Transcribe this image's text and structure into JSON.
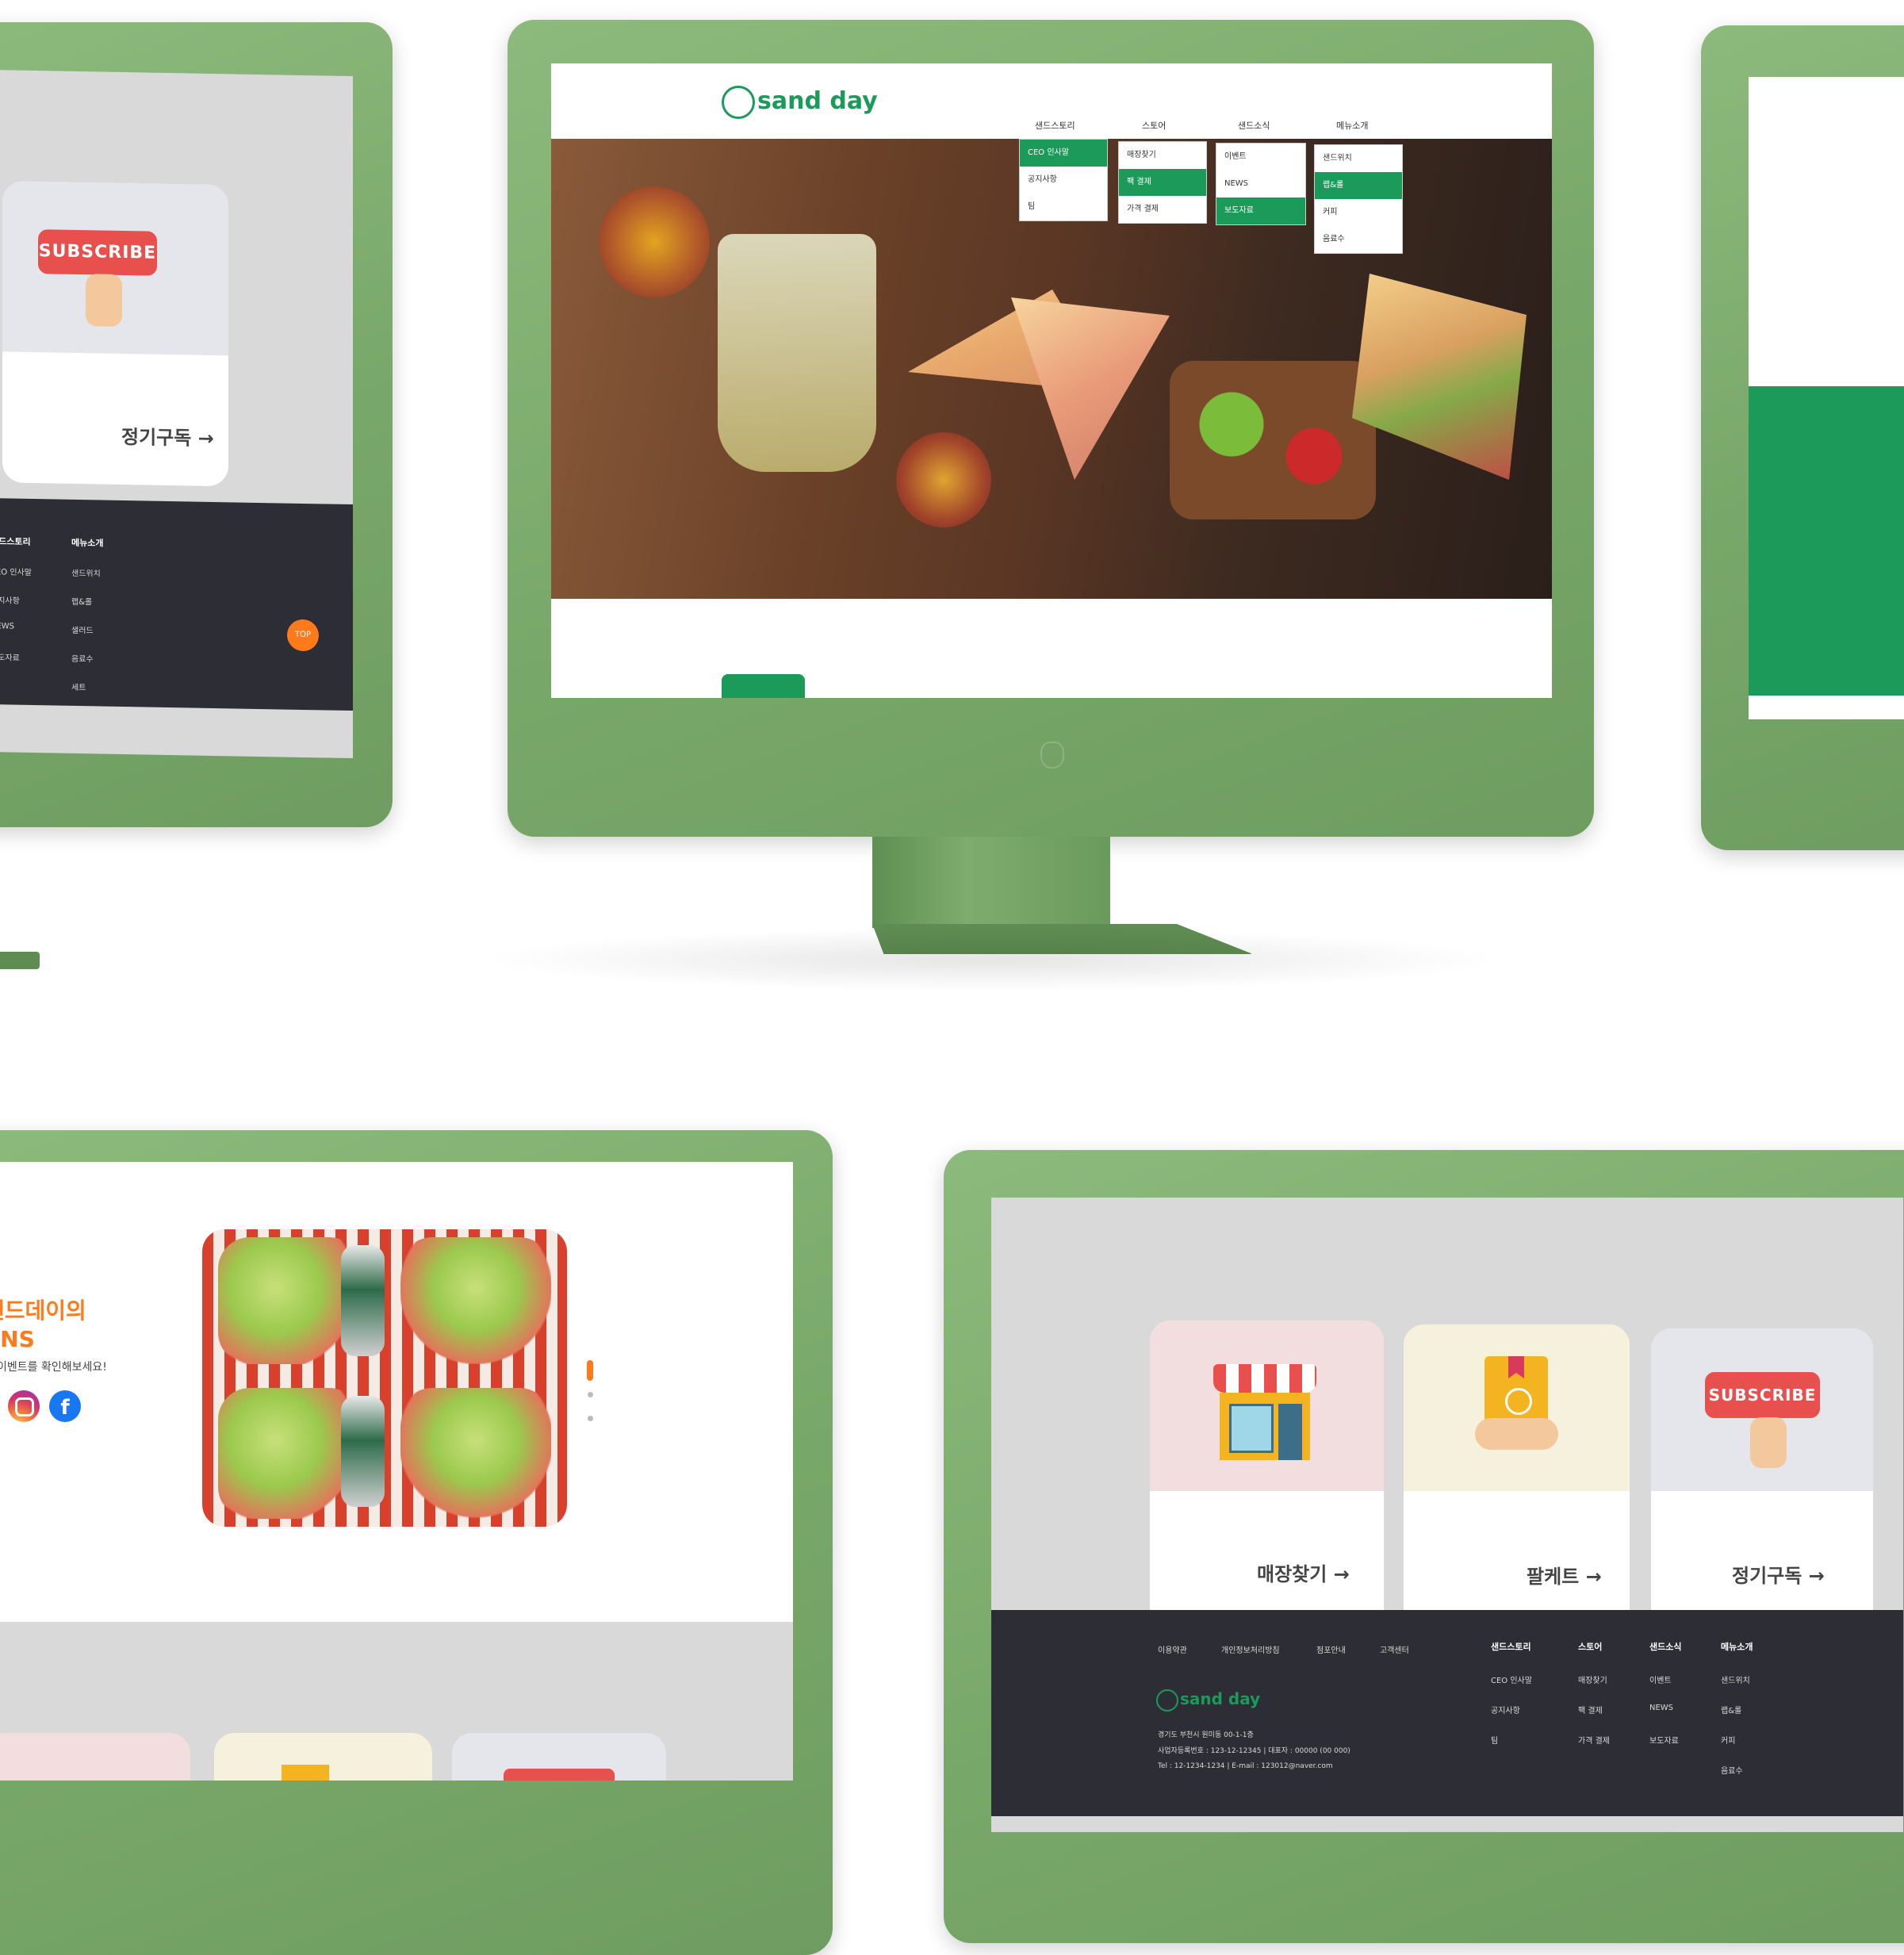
{
  "brand": {
    "logo_text": "sand day",
    "accent_color": "#1c9a5a",
    "orange_color": "#ff7a1a",
    "monitor_color": "#7aaa6b"
  },
  "top_left": {
    "subscribe_sign": "SUBSCRIBE",
    "card_label": "정기구독 →",
    "footer_headings": [
      "샌드스토리",
      "메뉴소개"
    ],
    "footer_items_col1": [
      "CEO 인사말",
      "공지사항",
      "NEWS",
      "보도자료"
    ],
    "footer_items_col2": [
      "샌드위치",
      "랩&롤",
      "샐러드",
      "음료수",
      "세트"
    ],
    "top_button": "TOP"
  },
  "center": {
    "nav": [
      "샌드스토리",
      "스토어",
      "샌드소식",
      "메뉴소개"
    ],
    "menus": [
      {
        "items": [
          "CEO 인사말",
          "공지사항",
          "팀"
        ],
        "active": 0
      },
      {
        "items": [
          "매장찾기",
          "팩 결제",
          "가격 결제"
        ],
        "active": 1
      },
      {
        "items": [
          "이벤트",
          "NEWS",
          "보도자료"
        ],
        "active": 2
      },
      {
        "items": [
          "샌드위치",
          "랩&롤",
          "커피",
          "음료수"
        ],
        "active": 1
      }
    ]
  },
  "bottom_left": {
    "title_line1": "샌드데이의",
    "title_line2": "SNS",
    "subtitle": "진행중인 이벤트를 확인해보세요!",
    "social": [
      "instagram-icon",
      "facebook-icon"
    ]
  },
  "bottom_right": {
    "cards": [
      {
        "label": "매장찾기 →",
        "icon": "store-icon",
        "bg": "#f2dede"
      },
      {
        "label": "팔케트 →",
        "icon": "catering-icon",
        "bg": "#f6f1dc"
      },
      {
        "label": "정기구독 →",
        "icon": "subscribe-icon",
        "bg": "#e5e6ec"
      }
    ],
    "subscribe_sign": "SUBSCRIBE",
    "footer_links": [
      "이용약관",
      "개인정보처리방침",
      "점포안내",
      "고객센터"
    ],
    "footer_logo": "sand day",
    "footer_address": [
      "경기도 부천시 원미동 00-1-1층",
      "사업자등록번호 : 123-12-12345 | 대표자 : 00000 (00 000)",
      "Tel : 12-1234-1234 | E-mail : 123012@naver.com"
    ],
    "footer_headings": [
      "샌드스토리",
      "스토어",
      "샌드소식",
      "메뉴소개"
    ],
    "footer_cols": [
      [
        "CEO 인사말",
        "공지사항",
        "팀"
      ],
      [
        "매장찾기",
        "팩 결제",
        "가격 결제"
      ],
      [
        "이벤트",
        "NEWS",
        "보도자료"
      ],
      [
        "샌드위치",
        "랩&롤",
        "커피",
        "음료수"
      ]
    ]
  }
}
